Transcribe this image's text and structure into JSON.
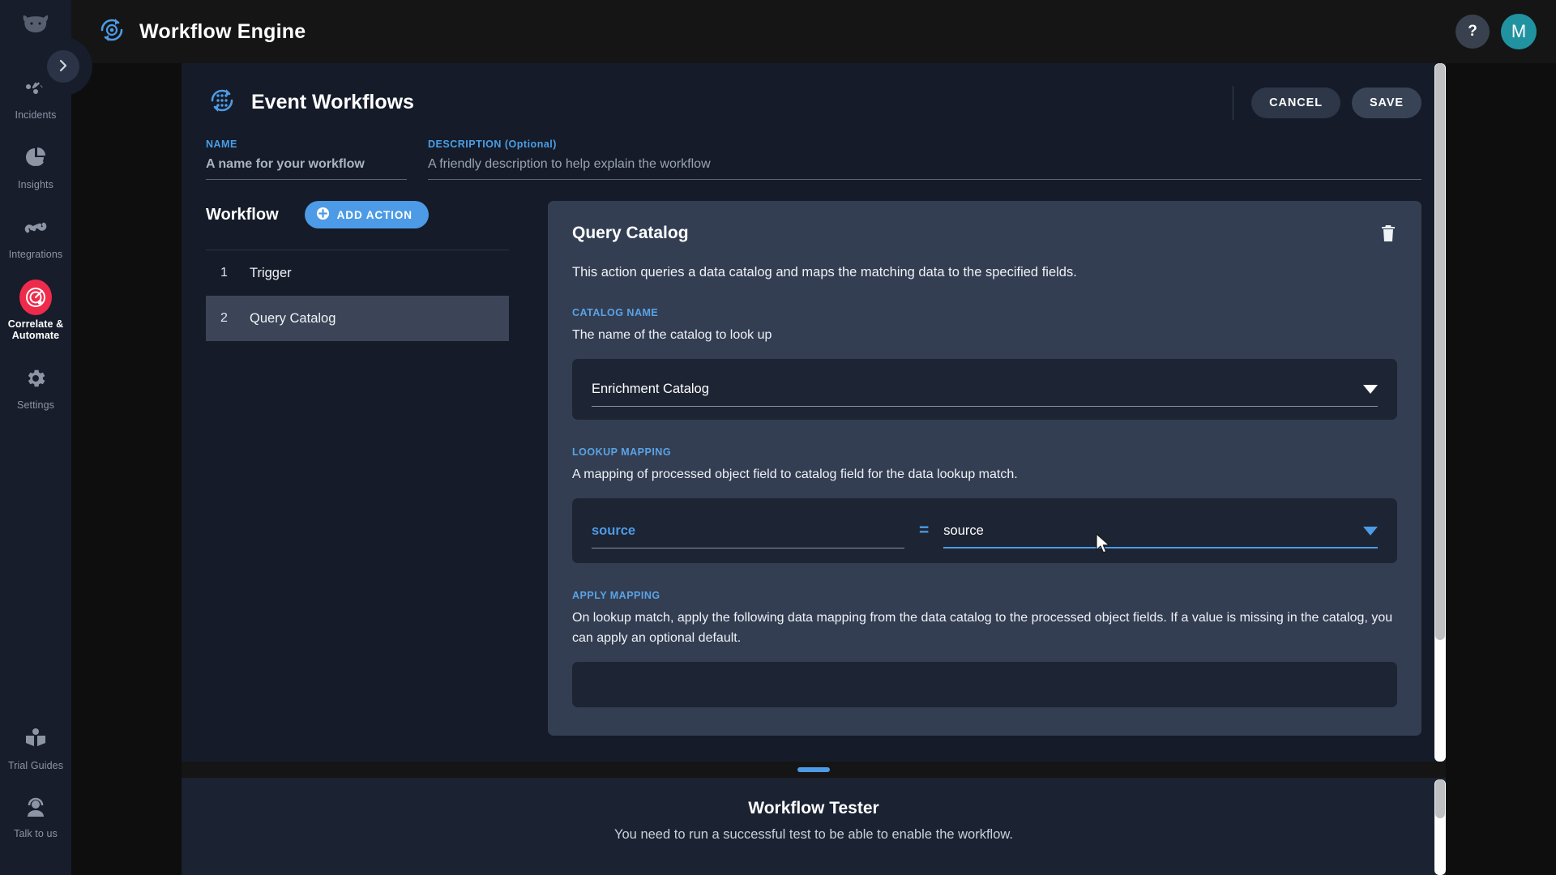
{
  "sidebar": {
    "logo_icon": "cow-head-logo",
    "collapse_icon": "chevron-right-icon",
    "items": [
      {
        "label": "Incidents",
        "icon": "incidents-nodes-icon",
        "active": false
      },
      {
        "label": "Insights",
        "icon": "pie-chart-icon",
        "active": false
      },
      {
        "label": "Integrations",
        "icon": "integrations-link-icon",
        "active": false
      },
      {
        "label": "Correlate & Automate",
        "icon": "radar-target-icon",
        "active": true
      },
      {
        "label": "Settings",
        "icon": "gear-icon",
        "active": false
      }
    ],
    "bottom_items": [
      {
        "label": "Trial Guides",
        "icon": "open-book-icon"
      },
      {
        "label": "Talk to us",
        "icon": "support-agent-icon"
      }
    ]
  },
  "topbar": {
    "title": "Workflow Engine",
    "brand_icon": "workflow-sync-icon",
    "help_label": "?",
    "avatar_initial": "M"
  },
  "page": {
    "title": "Event Workflows",
    "title_icon": "event-workflows-grid-icon",
    "cancel_label": "CANCEL",
    "save_label": "SAVE"
  },
  "meta": {
    "name_label": "NAME",
    "name_placeholder": "A name for your workflow",
    "description_label": "DESCRIPTION (Optional)",
    "description_placeholder": "A friendly description to help explain the workflow"
  },
  "workflow": {
    "heading": "Workflow",
    "add_action_label": "ADD ACTION",
    "add_action_icon": "plus-circle-icon",
    "steps": [
      {
        "num": "1",
        "name": "Trigger",
        "selected": false
      },
      {
        "num": "2",
        "name": "Query Catalog",
        "selected": true
      }
    ]
  },
  "detail": {
    "title": "Query Catalog",
    "delete_icon": "trash-icon",
    "description": "This action queries a data catalog and maps the matching data to the specified fields.",
    "catalog_name": {
      "label": "CATALOG NAME",
      "sublabel": "The name of the catalog to look up",
      "value": "Enrichment Catalog",
      "caret_icon": "chevron-down-icon"
    },
    "lookup_mapping": {
      "label": "LOOKUP MAPPING",
      "sublabel": "A mapping of processed object field to catalog field for the data lookup match.",
      "left_value": "source",
      "operator": "=",
      "right_value": "source",
      "caret_icon": "chevron-down-icon"
    },
    "apply_mapping": {
      "label": "APPLY MAPPING",
      "sublabel": "On lookup match, apply the following data mapping from the data catalog to the processed object fields. If a value is missing in the catalog, you can apply an optional default."
    }
  },
  "tester": {
    "title": "Workflow Tester",
    "subtitle": "You need to run a successful test to be able to enable the workflow.",
    "drag_handle_icon": "resize-handle-icon"
  },
  "colors": {
    "accent_blue": "#4d9be6",
    "brand_red": "#ef2b4b",
    "avatar_teal": "#2192a0",
    "panel_dark": "#151b28",
    "detail_panel": "#333e52",
    "inset_panel": "#1d2433",
    "selected_row": "#3b4557"
  }
}
